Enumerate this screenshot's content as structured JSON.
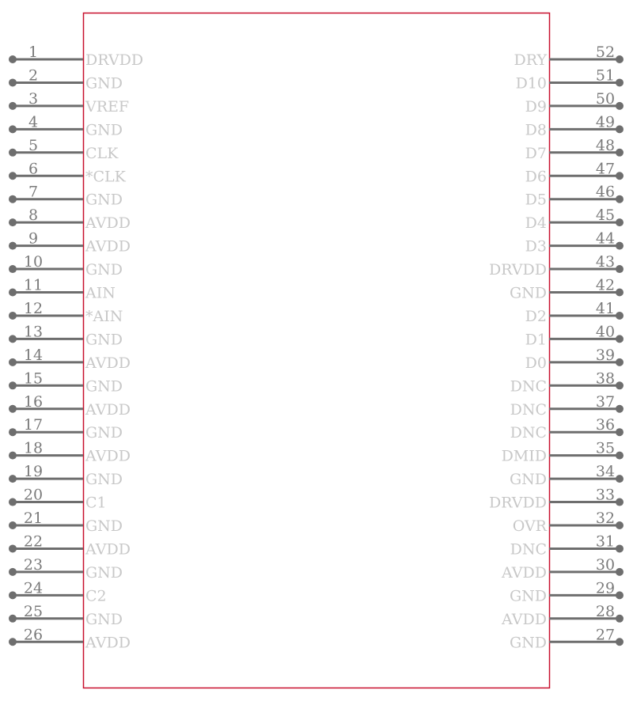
{
  "component": {
    "body_color": "#c8102e",
    "pin_color": "#6e6e6e",
    "label_color": "#c8c8c8",
    "left_pins": [
      {
        "num": "1",
        "name": "DRVDD"
      },
      {
        "num": "2",
        "name": "GND"
      },
      {
        "num": "3",
        "name": "VREF"
      },
      {
        "num": "4",
        "name": "GND"
      },
      {
        "num": "5",
        "name": "CLK"
      },
      {
        "num": "6",
        "name": "*CLK"
      },
      {
        "num": "7",
        "name": "GND"
      },
      {
        "num": "8",
        "name": "AVDD"
      },
      {
        "num": "9",
        "name": "AVDD"
      },
      {
        "num": "10",
        "name": "GND"
      },
      {
        "num": "11",
        "name": "AIN"
      },
      {
        "num": "12",
        "name": "*AIN"
      },
      {
        "num": "13",
        "name": "GND"
      },
      {
        "num": "14",
        "name": "AVDD"
      },
      {
        "num": "15",
        "name": "GND"
      },
      {
        "num": "16",
        "name": "AVDD"
      },
      {
        "num": "17",
        "name": "GND"
      },
      {
        "num": "18",
        "name": "AVDD"
      },
      {
        "num": "19",
        "name": "GND"
      },
      {
        "num": "20",
        "name": "C1"
      },
      {
        "num": "21",
        "name": "GND"
      },
      {
        "num": "22",
        "name": "AVDD"
      },
      {
        "num": "23",
        "name": "GND"
      },
      {
        "num": "24",
        "name": "C2"
      },
      {
        "num": "25",
        "name": "GND"
      },
      {
        "num": "26",
        "name": "AVDD"
      }
    ],
    "right_pins": [
      {
        "num": "52",
        "name": "DRY"
      },
      {
        "num": "51",
        "name": "D10"
      },
      {
        "num": "50",
        "name": "D9"
      },
      {
        "num": "49",
        "name": "D8"
      },
      {
        "num": "48",
        "name": "D7"
      },
      {
        "num": "47",
        "name": "D6"
      },
      {
        "num": "46",
        "name": "D5"
      },
      {
        "num": "45",
        "name": "D4"
      },
      {
        "num": "44",
        "name": "D3"
      },
      {
        "num": "43",
        "name": "DRVDD"
      },
      {
        "num": "42",
        "name": "GND"
      },
      {
        "num": "41",
        "name": "D2"
      },
      {
        "num": "40",
        "name": "D1"
      },
      {
        "num": "39",
        "name": "D0"
      },
      {
        "num": "38",
        "name": "DNC"
      },
      {
        "num": "37",
        "name": "DNC"
      },
      {
        "num": "36",
        "name": "DNC"
      },
      {
        "num": "35",
        "name": "DMID"
      },
      {
        "num": "34",
        "name": "GND"
      },
      {
        "num": "33",
        "name": "DRVDD"
      },
      {
        "num": "32",
        "name": "OVR"
      },
      {
        "num": "31",
        "name": "DNC"
      },
      {
        "num": "30",
        "name": "AVDD"
      },
      {
        "num": "29",
        "name": "GND"
      },
      {
        "num": "28",
        "name": "AVDD"
      },
      {
        "num": "27",
        "name": "GND"
      }
    ]
  }
}
